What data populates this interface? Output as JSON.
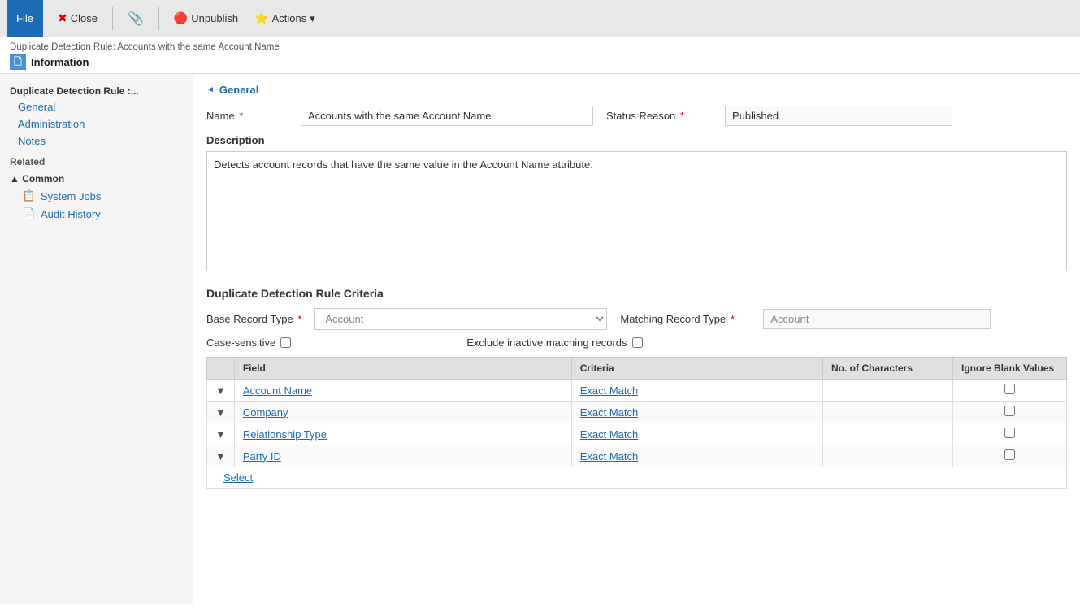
{
  "toolbar": {
    "file_label": "File",
    "close_label": "Close",
    "attach_label": "",
    "unpublish_label": "Unpublish",
    "actions_label": "Actions",
    "actions_arrow": "▾"
  },
  "page_header": {
    "breadcrumb": "Duplicate Detection Rule: Accounts with the same Account Name",
    "title": "Information",
    "title_icon": "🗋"
  },
  "sidebar": {
    "nav_section_title": "Duplicate Detection Rule :...",
    "nav_items": [
      {
        "label": "General"
      },
      {
        "label": "Administration"
      },
      {
        "label": "Notes"
      }
    ],
    "related_label": "Related",
    "common_label": "▲ Common",
    "common_items": [
      {
        "label": "System Jobs",
        "icon": "📋"
      },
      {
        "label": "Audit History",
        "icon": "📄"
      }
    ]
  },
  "general_section": {
    "toggle": "◄",
    "title": "General",
    "name_label": "Name",
    "name_value": "Accounts with the same Account Name",
    "status_reason_label": "Status Reason",
    "status_reason_value": "Published",
    "description_label": "Description",
    "description_value": "Detects account records that have the same value in the Account Name attribute."
  },
  "criteria_section": {
    "title": "Duplicate Detection Rule Criteria",
    "base_record_type_label": "Base Record Type",
    "base_record_type_value": "Account",
    "matching_record_type_label": "Matching Record Type",
    "matching_record_type_value": "Account",
    "case_sensitive_label": "Case-sensitive",
    "exclude_inactive_label": "Exclude inactive matching records",
    "table_headers": [
      "",
      "Field",
      "Criteria",
      "No. of Characters",
      "Ignore Blank Values"
    ],
    "table_rows": [
      {
        "expand": "▼",
        "field": "Account Name",
        "criteria": "Exact Match",
        "no_of_chars": "",
        "ignore_blank": false
      },
      {
        "expand": "▼",
        "field": "Company",
        "criteria": "Exact Match",
        "no_of_chars": "",
        "ignore_blank": false
      },
      {
        "expand": "▼",
        "field": "Relationship Type",
        "criteria": "Exact Match",
        "no_of_chars": "",
        "ignore_blank": false
      },
      {
        "expand": "▼",
        "field": "Party ID",
        "criteria": "Exact Match",
        "no_of_chars": "",
        "ignore_blank": false
      }
    ],
    "select_link": "Select"
  }
}
